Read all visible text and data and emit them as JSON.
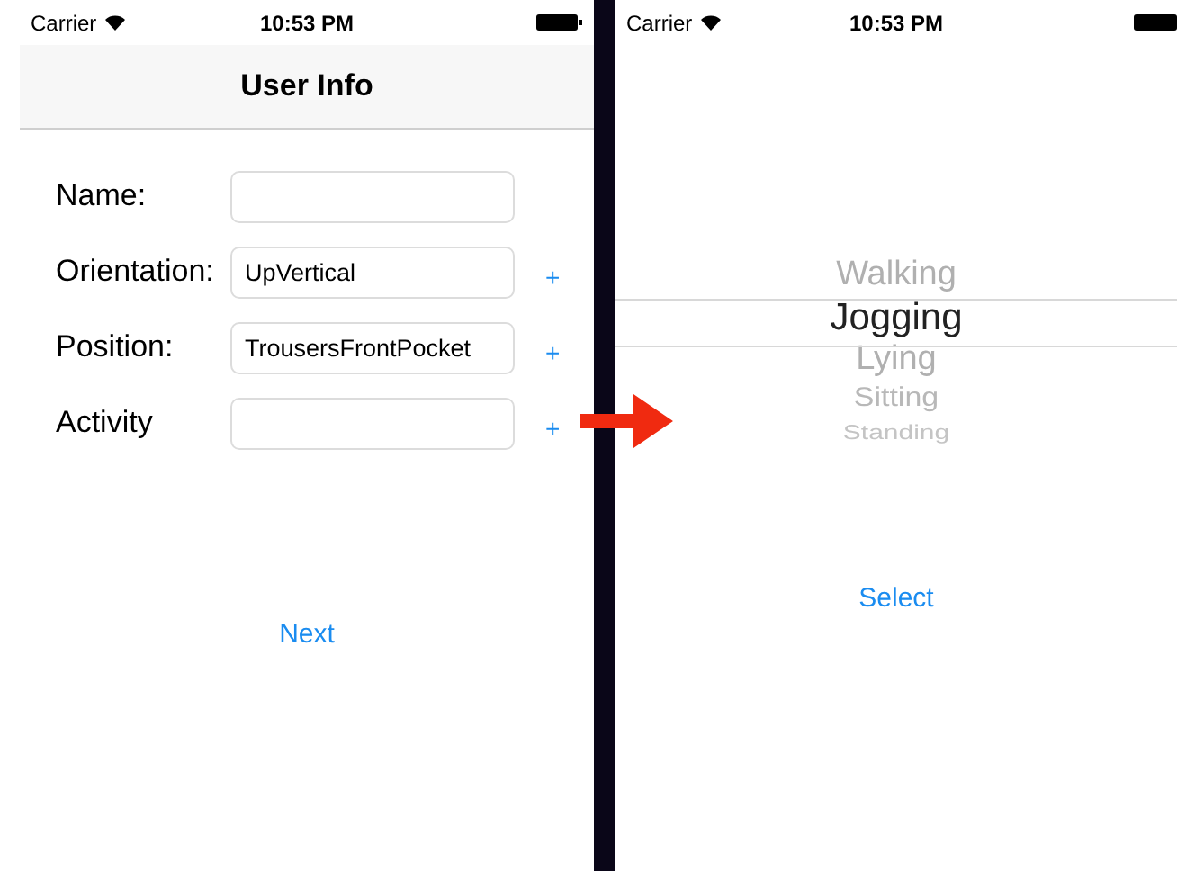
{
  "left_screen": {
    "status_bar": {
      "carrier": "Carrier",
      "time": "10:53 PM"
    },
    "nav_title": "User Info",
    "fields": [
      {
        "label": "Name:"
      },
      {
        "label": "Orientation:",
        "value": "UpVertical",
        "add": "+"
      },
      {
        "label": "Position:",
        "value": "TrousersFrontPocket",
        "add": "+"
      },
      {
        "label": "Activity",
        "add": "+"
      }
    ],
    "next_button": "Next"
  },
  "right_screen": {
    "status_bar": {
      "carrier": "Carrier",
      "time": "10:53 PM"
    },
    "picker": [
      {
        "label": "Walking",
        "selected": false
      },
      {
        "label": "Jogging",
        "selected": true
      },
      {
        "label": "Lying",
        "selected": false
      },
      {
        "label": "Sitting",
        "selected": false
      },
      {
        "label": "Standing",
        "selected": false
      }
    ],
    "select_button": "Select"
  }
}
